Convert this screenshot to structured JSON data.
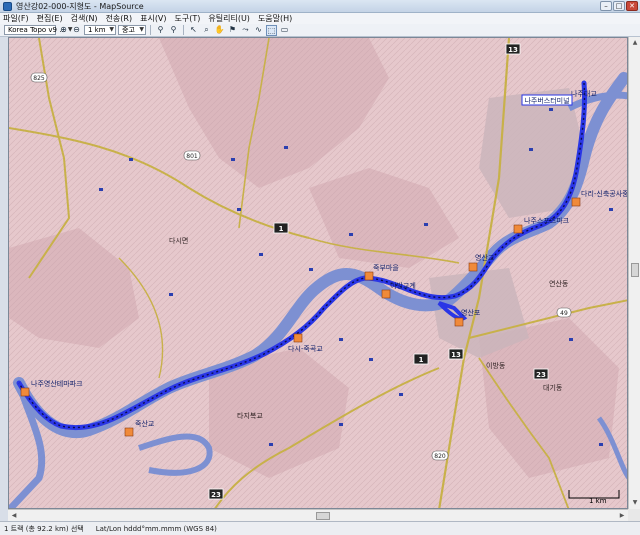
{
  "window": {
    "title": "영산강02-000-지형도 - MapSource"
  },
  "menu": [
    "파일(F)",
    "편집(E)",
    "검색(N)",
    "전송(R)",
    "표시(V)",
    "도구(T)",
    "유틸리티(U)",
    "도움말(H)"
  ],
  "toolbar": {
    "product": "Korea Topo v9 ...",
    "zoom": "1 km",
    "detail": "중고"
  },
  "map": {
    "pois": [
      {
        "id": "naju-daegyo",
        "label": "나주대교"
      },
      {
        "id": "naju-bus",
        "label": "나주버스터미널"
      },
      {
        "id": "dari-sinchuk",
        "label": "다리-신축공사중"
      },
      {
        "id": "naju-sports",
        "label": "나주스포츠파크"
      },
      {
        "id": "yeongsan-gyo",
        "label": "영산교"
      },
      {
        "id": "jukbu",
        "label": "죽부마을"
      },
      {
        "id": "ibang",
        "label": "이방교계"
      },
      {
        "id": "yeongsan-po",
        "label": "영산포"
      },
      {
        "id": "dasi-jukgok",
        "label": "다시-죽곡교"
      },
      {
        "id": "naju-yeongsan-park",
        "label": "나주영산테마파크"
      },
      {
        "id": "jukgeon",
        "label": "죽산교"
      }
    ],
    "places": [
      {
        "id": "dasimyeon",
        "label": "다시면"
      },
      {
        "id": "yeonsandong",
        "label": "연산동"
      },
      {
        "id": "tajido",
        "label": "타지복교"
      },
      {
        "id": "ibangdong",
        "label": "이방동"
      },
      {
        "id": "daegidong",
        "label": "대기동"
      }
    ],
    "shields": [
      "13",
      "1",
      "13",
      "23",
      "23",
      "1",
      "49",
      "825",
      "801",
      "820"
    ],
    "scale": "1 km"
  },
  "status": {
    "track": "1 트랙 (총 92.2 km) 선택",
    "coords": "Lat/Lon hddd°mm.mmm (WGS 84)"
  },
  "colors": {
    "route": "#2a36e6",
    "water": "#7d90d2",
    "land": "#e6c8cc",
    "road": "#c8b14a"
  }
}
